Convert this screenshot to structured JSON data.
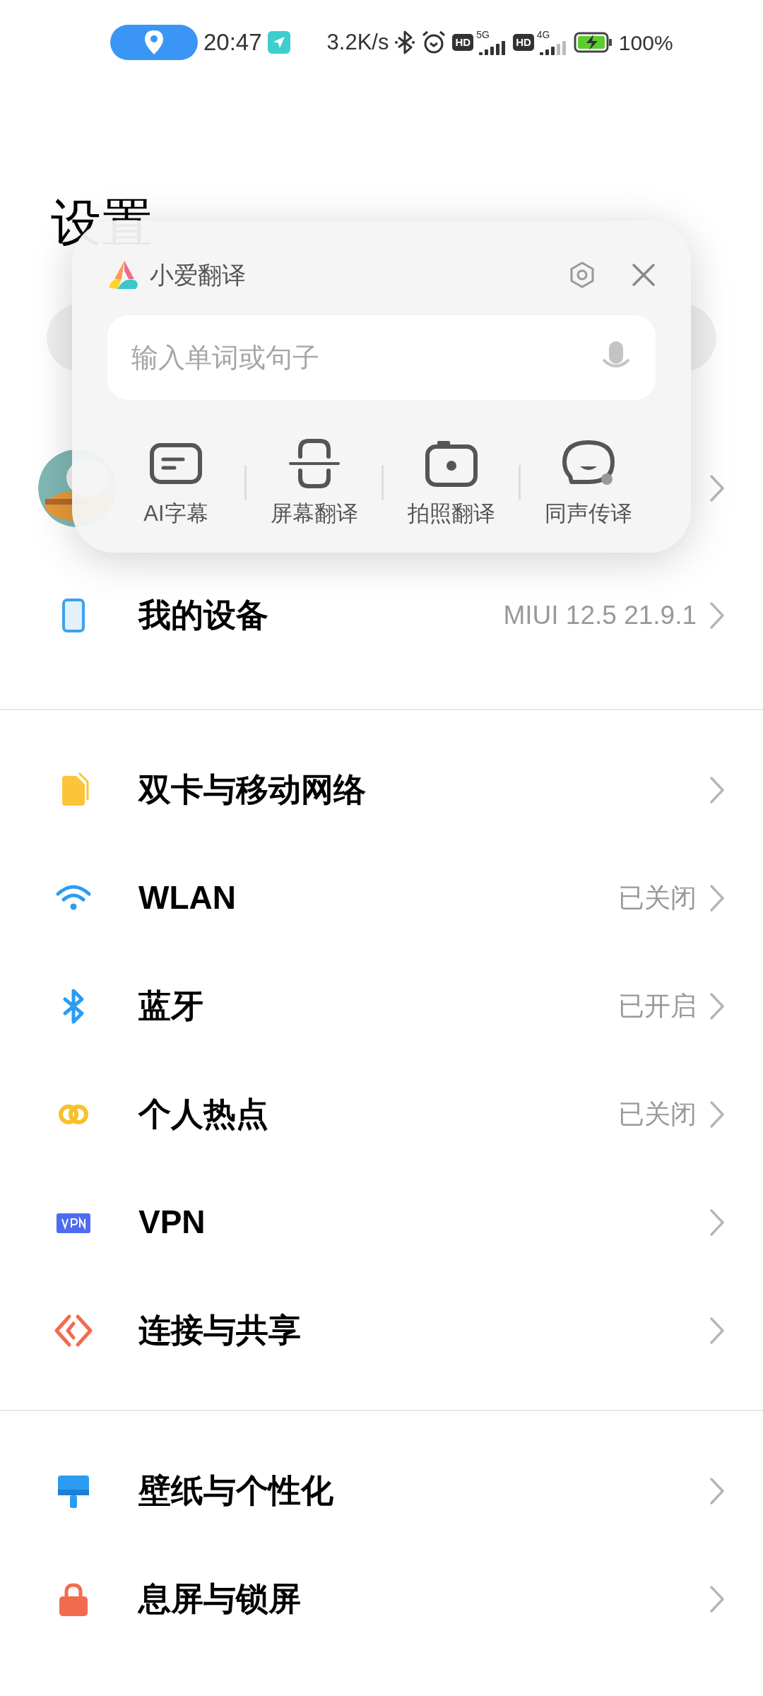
{
  "status_bar": {
    "time": "20:47",
    "net_speed": "3.2K/s",
    "sims": [
      {
        "hd": "HD",
        "network": "5G"
      },
      {
        "hd": "HD",
        "network": "4G"
      }
    ],
    "battery": "100%"
  },
  "page": {
    "title": "设置"
  },
  "translator": {
    "title": "小爱翻译",
    "input": {
      "placeholder": "输入单词或句子"
    },
    "tools": [
      {
        "kind": "subtitles",
        "label": "AI字幕"
      },
      {
        "kind": "scan",
        "label": "屏幕翻译"
      },
      {
        "kind": "camera",
        "label": "拍照翻译"
      },
      {
        "kind": "speech",
        "label": "同声传译"
      }
    ]
  },
  "sections": [
    [
      {
        "kind": "device",
        "label": "我的设备",
        "value": "MIUI 12.5 21.9.1"
      }
    ],
    [
      {
        "kind": "sim",
        "label": "双卡与移动网络"
      },
      {
        "kind": "wifi",
        "label": "WLAN",
        "value": "已关闭"
      },
      {
        "kind": "bluetooth",
        "label": "蓝牙",
        "value": "已开启"
      },
      {
        "kind": "hotspot",
        "label": "个人热点",
        "value": "已关闭"
      },
      {
        "kind": "vpn",
        "label": "VPN"
      },
      {
        "kind": "share",
        "label": "连接与共享"
      }
    ],
    [
      {
        "kind": "wallpaper",
        "label": "壁纸与个性化"
      },
      {
        "kind": "lock",
        "label": "息屏与锁屏"
      }
    ]
  ]
}
